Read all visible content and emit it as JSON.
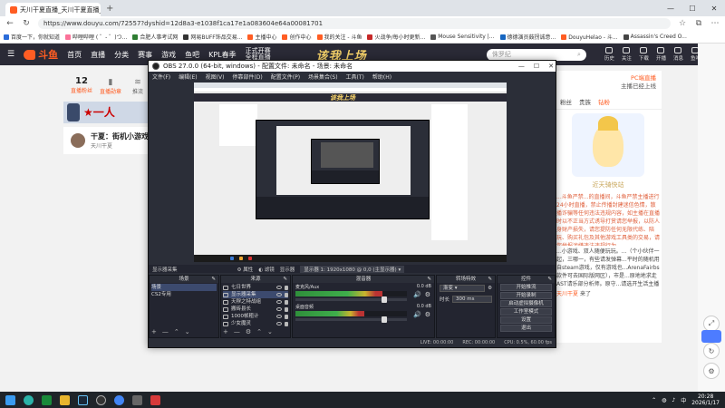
{
  "browser": {
    "tab_title": "天川干夏直播_天川干夏直播_天川...",
    "address": "https://www.douyu.com/72557?dyshid=12d8a3-e1038f1ca17e1a083604e64a00081701",
    "bookmarks": [
      "百度一下，你就知道",
      "哔哩哔哩 ( ゜- ゜)つ...",
      "合肥人事考试网",
      "网易BUFF饰品交易...",
      "主播中心",
      "创作中心",
      "我的关注 - 斗鱼",
      "火战争/每小时更新...",
      "Mouse Sensitivity |...",
      "德德演员鼓拐诚意...",
      "DouyuHelao - 斗...",
      "Assassin's Creed O..."
    ]
  },
  "douyu": {
    "logo": "斗鱼",
    "nav": [
      "首页",
      "直播",
      "分类",
      "赛事",
      "游戏",
      "鱼吧",
      "KPL春季"
    ],
    "kpl_line1": "正式开赛",
    "kpl_line2": "全程直播",
    "banner": "该我上场",
    "search_placeholder": "侏罗纪",
    "top_icons": [
      "历史",
      "关注",
      "下载",
      "开播",
      "消息",
      "鱼吧",
      "任务"
    ],
    "fans_num": "12",
    "fans_label": "直播粉丝",
    "stat2_label": "直播勋章",
    "stat3_label": "推流",
    "banner_red": "★一人",
    "streamer_title": "干夏：街机小游戏",
    "streamer_name": "天川干夏"
  },
  "rightpanel": {
    "top1": "PC端直播",
    "top2": "主播已经上线",
    "tabs": [
      "粉丝",
      "贵族",
      "钻粉"
    ],
    "img_caption": "近天骑快站",
    "text_red": "...斗鱼严禁...的直播间，斗鱼严禁主播进行24小时直播，禁止传播封建迷信色情，散播诈骗等任何违法违规内容，如主播在直播时以不正当方式诱导打赏请您举报，以防人身财产损失，请您提防任何无限代练、陪玩、购买礼包及其他游戏工具类的交易，请您举报涉嫌违法违规行为。",
    "text_black": "...小游戏、双人随便玩玩。...（个小伙伴一起，三哪一，有些请发弹幕...平时的随机用自steam游戏，仅有游戏也...ArenaFairbs款件可去国际版网区），市是...原地地求走AST请乐部分析师。原守...请选开生活主播要手等，战术要敲窝分析...",
    "chat_user": "天川干夏",
    "chat_text": "来了"
  },
  "obs": {
    "title": "OBS 27.0.0 (64-bit, windows) - 配置文件: 未命名 - 场景: 未命名",
    "menu": [
      "文件(F)",
      "编辑(E)",
      "视图(V)",
      "停靠部件(D)",
      "配置文件(P)",
      "场景集合(S)",
      "工具(T)",
      "帮助(H)"
    ],
    "source_label": "显示器采集",
    "ctrl_props": "属性",
    "ctrl_filter": "滤镜",
    "ctrl_display": "显示器",
    "ctrl_display_val": "显示器 1: 1920x1080 @ 0,0 (主显示器)",
    "docks": {
      "scenes_title": "场景",
      "sources_title": "来源",
      "mixer_title": "混音器",
      "transitions_title": "转场特效",
      "controls_title": "控件"
    },
    "scenes": [
      "场景",
      "CS2专用"
    ],
    "sources": [
      "七日世界",
      "显示器采集",
      "天穆之特战组",
      "搬砖县长",
      "1000帧粗计",
      "少女魔灵"
    ],
    "mixer": [
      {
        "name": "麦克风/Aux",
        "db": "0.0 dB",
        "level": 0.78,
        "knob": 0.8
      },
      {
        "name": "桌面音频",
        "db": "0.0 dB",
        "level": 0.62,
        "knob": 0.8
      }
    ],
    "transition_type": "渐变",
    "duration_label": "时长",
    "duration_val": "300 ms",
    "controls": [
      "开始推流",
      "开始录制",
      "启动虚拟摄像机",
      "工作室模式",
      "设置",
      "退出"
    ],
    "status": [
      "LIVE: 00:00:00",
      "REC: 00:00:00",
      "CPU: 0.5%, 60.00 fps"
    ]
  },
  "taskbar": {
    "time": "20:28",
    "date": "2026/1/17",
    "lang": "中"
  }
}
